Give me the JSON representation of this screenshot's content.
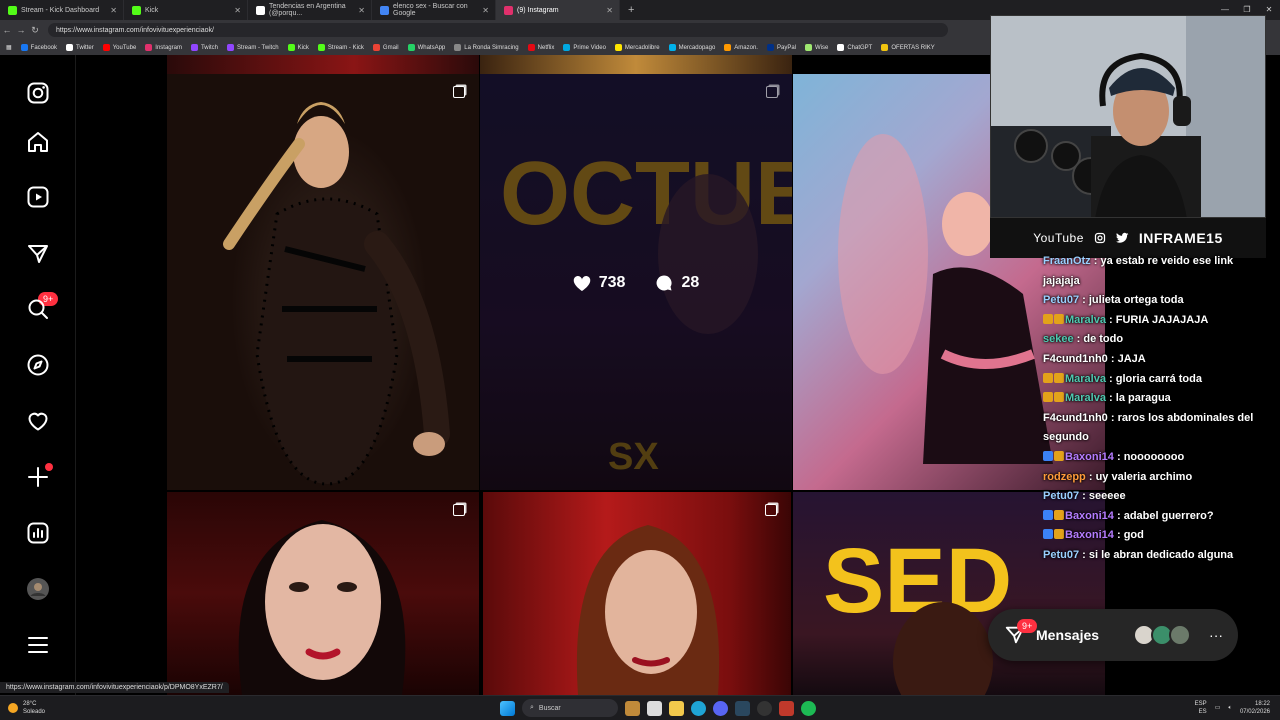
{
  "browser": {
    "tabs": [
      {
        "label": "Stream - Kick Dashboard",
        "color": "#53fc18"
      },
      {
        "label": "Kick",
        "color": "#53fc18"
      },
      {
        "label": "Tendencias en Argentina (@porqu...",
        "color": "#ffffff"
      },
      {
        "label": "elenco sex - Buscar con Google",
        "color": "#4285f4"
      },
      {
        "label": "(9) Instagram",
        "color": "#e1306c"
      }
    ],
    "new_tab": "+",
    "url": "https://www.instagram.com/infovivituexperienciaok/",
    "bookmarks": [
      {
        "label": "Facebook",
        "color": "#1877f2"
      },
      {
        "label": "Twitter",
        "color": "#ffffff"
      },
      {
        "label": "YouTube",
        "color": "#ff0000"
      },
      {
        "label": "Instagram",
        "color": "#e1306c"
      },
      {
        "label": "Twitch",
        "color": "#9146ff"
      },
      {
        "label": "Stream - Twitch",
        "color": "#9146ff"
      },
      {
        "label": "Kick",
        "color": "#53fc18"
      },
      {
        "label": "Stream - Kick",
        "color": "#53fc18"
      },
      {
        "label": "Gmail",
        "color": "#ea4335"
      },
      {
        "label": "WhatsApp",
        "color": "#25d366"
      },
      {
        "label": "La Ronda Simracing",
        "color": "#888888"
      },
      {
        "label": "Netflix",
        "color": "#e50914"
      },
      {
        "label": "Prime Video",
        "color": "#00a8e1"
      },
      {
        "label": "Mercadolibre",
        "color": "#ffe600"
      },
      {
        "label": "Mercadopago",
        "color": "#00b1ea"
      },
      {
        "label": "Amazon.",
        "color": "#ff9900"
      },
      {
        "label": "PayPal",
        "color": "#003087"
      },
      {
        "label": "Wise",
        "color": "#9fe870"
      },
      {
        "label": "ChatGPT",
        "color": "#ffffff"
      },
      {
        "label": "OFERTAS RIKY",
        "color": "#f1c40f"
      }
    ]
  },
  "sidebar": {
    "icons": [
      "instagram-logo-icon",
      "home-icon",
      "reels-icon",
      "direct-icon",
      "search-icon",
      "explore-icon",
      "notifications-icon",
      "create-icon",
      "dashboard-icon",
      "profile-avatar",
      "menu-icon"
    ],
    "direct_badge": "9+"
  },
  "post_hover": {
    "likes": "738",
    "comments": "28"
  },
  "post_text": {
    "poster_title": "OCTUBRE",
    "poster_logo": "SX",
    "poster2_title": "SED"
  },
  "cam_footer": {
    "youtube": "YouTube",
    "channel": "INFRAME15"
  },
  "chat": [
    {
      "user": "FraanOtz",
      "color": "#9ad0ff",
      "text": "ya estab re veido ese link jajajaja",
      "badges": []
    },
    {
      "user": "Petu07",
      "color": "#9ad0ff",
      "text": "julieta ortega toda",
      "badges": []
    },
    {
      "user": "Maralva",
      "color": "#4ec9b0",
      "text": "FURIA JAJAJAJA",
      "badges": [
        "#e3a21a",
        "#e3a21a"
      ]
    },
    {
      "user": "sekee",
      "color": "#4ec9b0",
      "text": "de todo",
      "badges": []
    },
    {
      "user": "F4cund1nh0",
      "color": "#ffffff",
      "text": "JAJA",
      "badges": []
    },
    {
      "user": "Maralva",
      "color": "#4ec9b0",
      "text": "gloria carrá toda",
      "badges": [
        "#e3a21a",
        "#e3a21a"
      ]
    },
    {
      "user": "Maralva",
      "color": "#4ec9b0",
      "text": "la paragua",
      "badges": [
        "#e3a21a",
        "#e3a21a"
      ]
    },
    {
      "user": "F4cund1nh0",
      "color": "#ffffff",
      "text": "raros los abdominales del segundo",
      "badges": []
    },
    {
      "user": "Baxoni14",
      "color": "#b57cff",
      "text": "noooooooo",
      "badges": [
        "#3b82f6",
        "#e3a21a"
      ]
    },
    {
      "user": "rodzepp",
      "color": "#ff9c3a",
      "text": "uy valeria archimo",
      "badges": []
    },
    {
      "user": "Petu07",
      "color": "#9ad0ff",
      "text": "seeeee",
      "badges": []
    },
    {
      "user": "Baxoni14",
      "color": "#b57cff",
      "text": "adabel guerrero?",
      "badges": [
        "#3b82f6",
        "#e3a21a"
      ]
    },
    {
      "user": "Baxoni14",
      "color": "#b57cff",
      "text": "god",
      "badges": [
        "#3b82f6",
        "#e3a21a"
      ]
    },
    {
      "user": "Petu07",
      "color": "#9ad0ff",
      "text": "si le abran dedicado alguna",
      "badges": []
    }
  ],
  "messages": {
    "label": "Mensajes",
    "badge": "9+",
    "more": "···"
  },
  "status_url": "https://www.instagram.com/infovivituexperienciaok/p/DPMO8YxEZR7/",
  "taskbar": {
    "temp": "28°C",
    "weather": "Soleado",
    "search": "Buscar",
    "lang1": "ESP",
    "lang2": "ES",
    "time": "18:22",
    "date": "07/02/2026"
  }
}
